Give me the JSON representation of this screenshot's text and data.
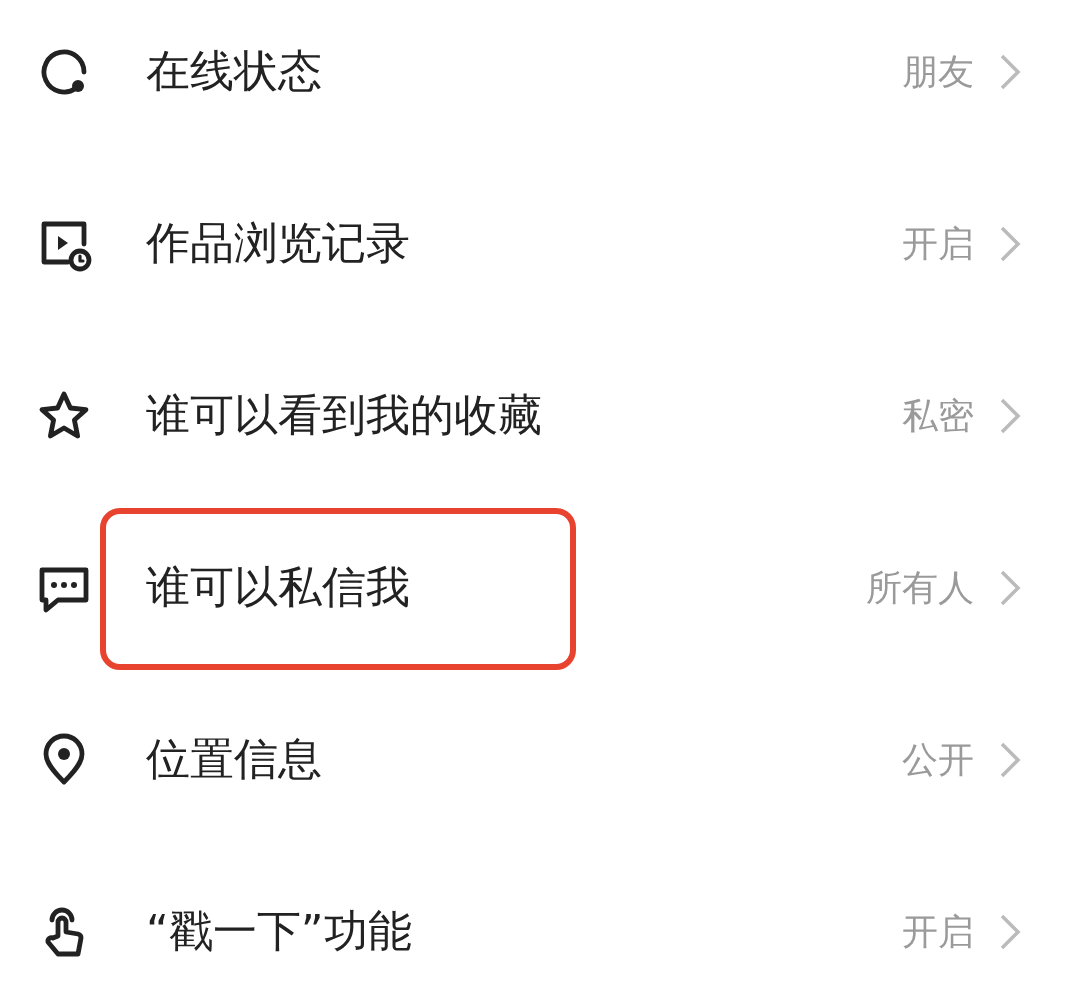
{
  "settings": [
    {
      "kind": "status",
      "label": "在线状态",
      "value": "朋友",
      "highlighted": false
    },
    {
      "kind": "history",
      "label": "作品浏览记录",
      "value": "开启",
      "highlighted": false
    },
    {
      "kind": "favorites",
      "label": "谁可以看到我的收藏",
      "value": "私密",
      "highlighted": false
    },
    {
      "kind": "messages",
      "label": "谁可以私信我",
      "value": "所有人",
      "highlighted": true
    },
    {
      "kind": "location",
      "label": "位置信息",
      "value": "公开",
      "highlighted": false
    },
    {
      "kind": "poke",
      "label": "“戳一下”功能",
      "value": "开启",
      "highlighted": false
    }
  ]
}
